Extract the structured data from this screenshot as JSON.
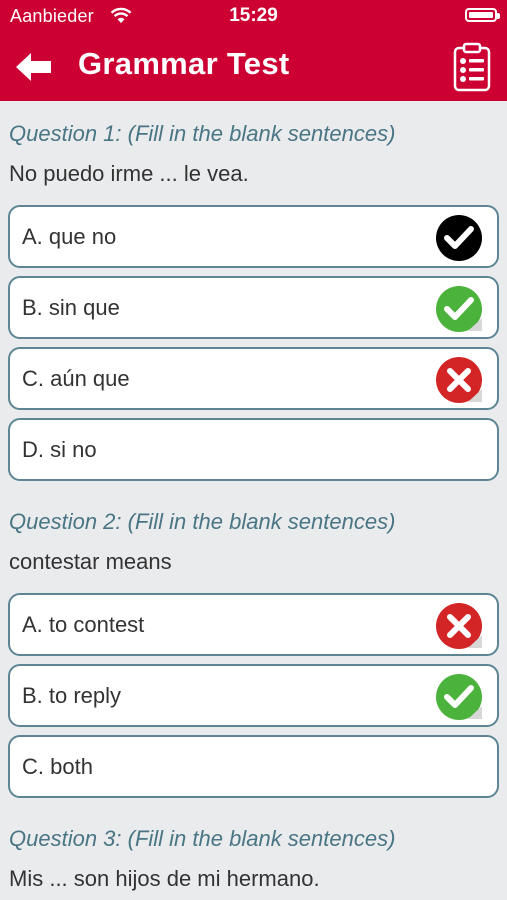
{
  "status": {
    "carrier": "Aanbieder",
    "time": "15:29"
  },
  "header": {
    "title": "Grammar Test",
    "back_icon": "arrow-left-icon",
    "right_icon": "clipboard-checklist-icon",
    "color": "#cc0033"
  },
  "questions": [
    {
      "title": "Question 1: (Fill in the blank sentences)",
      "text": "No puedo irme ... le vea.",
      "options": [
        {
          "label": "A. que no",
          "mark": "selected-check"
        },
        {
          "label": "B. sin que",
          "mark": "correct"
        },
        {
          "label": "C. aún que",
          "mark": "wrong"
        },
        {
          "label": "D. si no",
          "mark": ""
        }
      ]
    },
    {
      "title": "Question 2: (Fill in the blank sentences)",
      "text": "contestar means",
      "options": [
        {
          "label": "A. to contest",
          "mark": "wrong"
        },
        {
          "label": "B. to reply",
          "mark": "correct"
        },
        {
          "label": "C. both",
          "mark": ""
        }
      ]
    },
    {
      "title": "Question 3: (Fill in the blank sentences)",
      "text": "Mis ... son hijos de mi hermano."
    }
  ]
}
